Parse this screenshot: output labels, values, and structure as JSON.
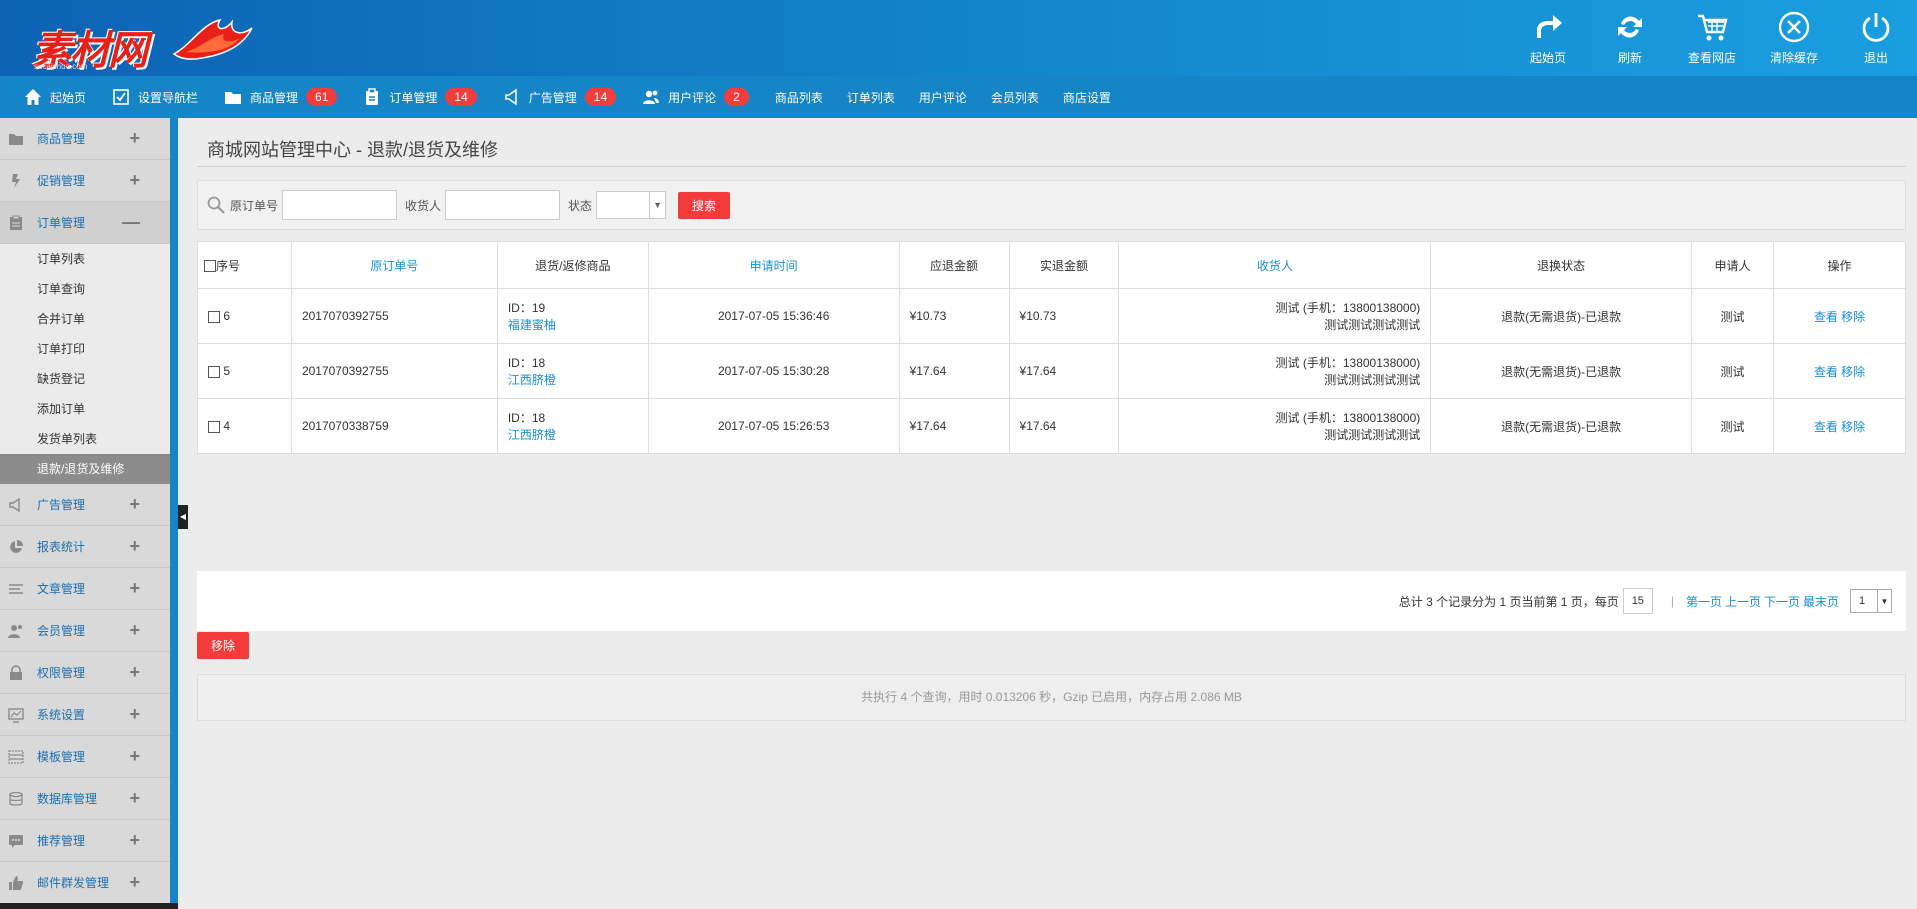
{
  "header": {
    "logo_text": "素材网",
    "logo_sub": "sucaishuo.com",
    "actions": [
      {
        "label": "起始页",
        "icon": "share-arrow-icon"
      },
      {
        "label": "刷新",
        "icon": "refresh-icon"
      },
      {
        "label": "查看网店",
        "icon": "cart-icon"
      },
      {
        "label": "清除缓存",
        "icon": "close-circle-icon"
      },
      {
        "label": "退出",
        "icon": "power-icon"
      }
    ]
  },
  "nav": {
    "items": [
      {
        "label": "起始页",
        "icon": "home-icon"
      },
      {
        "label": "设置导航栏",
        "icon": "checklist-icon"
      },
      {
        "label": "商品管理",
        "icon": "folder-icon",
        "badge": "61"
      },
      {
        "label": "订单管理",
        "icon": "clipboard-icon",
        "badge": "14"
      },
      {
        "label": "广告管理",
        "icon": "speaker-icon",
        "badge": "14"
      },
      {
        "label": "用户评论",
        "icon": "users-icon",
        "badge": "2"
      }
    ],
    "links": [
      "商品列表",
      "订单列表",
      "用户评论",
      "会员列表",
      "商店设置"
    ]
  },
  "sidebar": {
    "groups_top": [
      {
        "label": "商品管理",
        "icon": "folder-icon",
        "toggle": "+"
      },
      {
        "label": "促销管理",
        "icon": "flash-icon",
        "toggle": "+"
      },
      {
        "label": "订单管理",
        "icon": "clipboard-icon",
        "toggle": "—"
      }
    ],
    "order_sub": [
      "订单列表",
      "订单查询",
      "合并订单",
      "订单打印",
      "缺货登记",
      "添加订单",
      "发货单列表",
      "退款/退货及维修"
    ],
    "groups_bottom": [
      {
        "label": "广告管理",
        "icon": "speaker-icon",
        "toggle": "+"
      },
      {
        "label": "报表统计",
        "icon": "pie-chart-icon",
        "toggle": "+"
      },
      {
        "label": "文章管理",
        "icon": "lines-icon",
        "toggle": "+"
      },
      {
        "label": "会员管理",
        "icon": "users-icon",
        "toggle": "+"
      },
      {
        "label": "权限管理",
        "icon": "lock-icon",
        "toggle": "+"
      },
      {
        "label": "系统设置",
        "icon": "monitor-icon",
        "toggle": "+"
      },
      {
        "label": "模板管理",
        "icon": "template-icon",
        "toggle": "+"
      },
      {
        "label": "数据库管理",
        "icon": "database-icon",
        "toggle": "+"
      },
      {
        "label": "推荐管理",
        "icon": "chat-icon",
        "toggle": "+"
      },
      {
        "label": "邮件群发管理",
        "icon": "thumbs-up-icon",
        "toggle": "+"
      }
    ],
    "toggle_arrow": "◀"
  },
  "main": {
    "title": "商城网站管理中心",
    "title_sep": " - ",
    "subtitle": "退款/退货及维修",
    "search": {
      "order_label": "原订单号",
      "receiver_label": "收货人",
      "status_label": "状态",
      "status_value": "",
      "status_arrow": "▼",
      "button": "搜索"
    },
    "table": {
      "headers": [
        "序号",
        "原订单号",
        "退货/返修商品",
        "申请时间",
        "应退金额",
        "实退金额",
        "收货人",
        "退换状态",
        "申请人",
        "操作"
      ],
      "rows": [
        {
          "seq": "6",
          "order": "2017070392755",
          "goods_id": "ID：19",
          "goods_name": "福建蜜柚",
          "time": "2017-07-05 15:36:46",
          "due": "¥10.73",
          "paid": "¥10.73",
          "receiver_1": "测试 (手机：13800138000)",
          "receiver_2": "测试测试测试测试",
          "status": "退款(无需退货)-已退款",
          "applicant": "测试",
          "view": "查看",
          "remove": "移除"
        },
        {
          "seq": "5",
          "order": "2017070392755",
          "goods_id": "ID：18",
          "goods_name": "江西脐橙",
          "time": "2017-07-05 15:30:28",
          "due": "¥17.64",
          "paid": "¥17.64",
          "receiver_1": "测试 (手机：13800138000)",
          "receiver_2": "测试测试测试测试",
          "status": "退款(无需退货)-已退款",
          "applicant": "测试",
          "view": "查看",
          "remove": "移除"
        },
        {
          "seq": "4",
          "order": "2017070338759",
          "goods_id": "ID：18",
          "goods_name": "江西脐橙",
          "time": "2017-07-05 15:26:53",
          "due": "¥17.64",
          "paid": "¥17.64",
          "receiver_1": "测试 (手机：13800138000)",
          "receiver_2": "测试测试测试测试",
          "status": "退款(无需退货)-已退款",
          "applicant": "测试",
          "view": "查看",
          "remove": "移除"
        }
      ]
    },
    "pager": {
      "summary": "总计 3 个记录分为 1 页当前第 1 页，每页",
      "per_page": "15",
      "sep": "|",
      "first": "第一页",
      "prev": "上一页",
      "next": "下一页",
      "last": "最末页",
      "page_value": "1",
      "page_arrow": "▼"
    },
    "remove_button": "移除",
    "footer": "共执行 4 个查询，用时 0.013206 秒，Gzip 已启用，内存占用 2.086 MB"
  },
  "colors": {
    "header_start": "#0d62b4",
    "nav": "#1585c7",
    "accent_red": "#f43b3b",
    "link": "#1a8fd6"
  }
}
